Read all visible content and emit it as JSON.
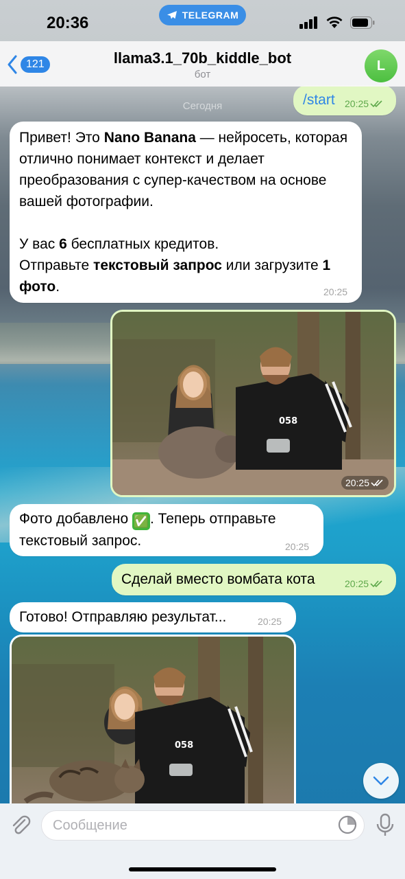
{
  "status": {
    "time": "20:36",
    "pill_label": "TELEGRAM"
  },
  "header": {
    "back_count": "121",
    "title": "llama3.1_70b_kiddle_bot",
    "subtitle": "бот",
    "avatar_letter": "L"
  },
  "date_separator": "Сегодня",
  "messages": {
    "start": {
      "text": "/start",
      "time": "20:25"
    },
    "welcome": {
      "p1_a": "Привет! Это ",
      "p1_b": "Nano Banana",
      "p1_c": " — нейросеть, которая отлично понимает контекст и делает преобразования с супер-качеством на основе вашей фотографии.",
      "p2_a": "У вас ",
      "p2_b": "6",
      "p2_c": " бесплатных кредитов.",
      "p3_a": "Отправьте ",
      "p3_b": "текстовый запрос",
      "p3_c": " или загрузите ",
      "p3_d": "1 фото",
      "p3_e": ".",
      "time": "20:25"
    },
    "photo_out": {
      "time": "20:25"
    },
    "photo_added": {
      "text_a": "Фото добавлено ",
      "emoji": "✅",
      "text_b": ". Теперь отправьте текстовый запрос.",
      "time": "20:25"
    },
    "request": {
      "text": "Сделай вместо вомбата кота",
      "time": "20:25"
    },
    "ready": {
      "text": "Готово! Отправляю результат...",
      "time": "20:25"
    }
  },
  "composer": {
    "placeholder": "Сообщение"
  },
  "icons": {
    "back": "chevron-left-icon",
    "attach": "paperclip-icon",
    "sticker": "sticker-icon",
    "mic": "microphone-icon",
    "scroll": "chevron-down-icon",
    "read": "double-check-icon"
  },
  "colors": {
    "accent": "#2f86e6",
    "outgoing_bubble": "#e1f7c3",
    "incoming_bubble": "#ffffff",
    "read_check": "#5ea84b"
  }
}
